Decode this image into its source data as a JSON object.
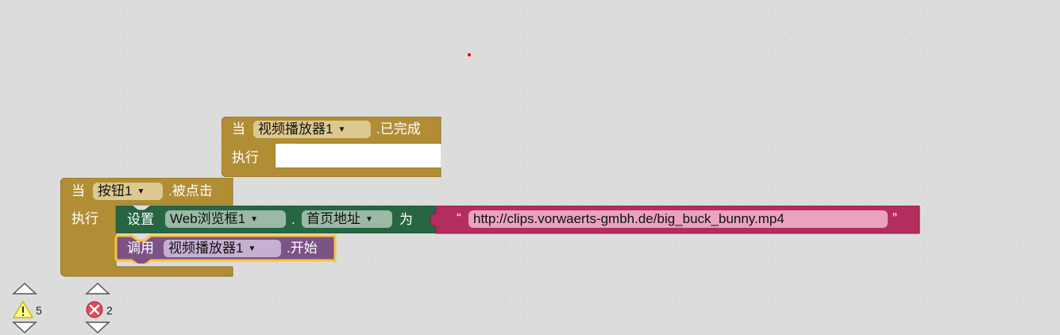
{
  "workspace": {
    "event_block_1": {
      "when_label": "当",
      "component": "视频播放器1",
      "event": ".已完成",
      "do_label": "执行"
    },
    "event_block_2": {
      "when_label": "当",
      "component": "按钮1",
      "event": ".被点击",
      "do_label": "执行"
    },
    "set_block": {
      "set_label": "设置",
      "component": "Web浏览框1",
      "dot": ".",
      "property": "首页地址",
      "to_label": "为"
    },
    "text_block": {
      "open_quote": "“",
      "value": "http://clips.vorwaerts-gmbh.de/big_buck_bunny.mp4",
      "close_quote": "”"
    },
    "call_block": {
      "call_label": "调用",
      "component": "视频播放器1",
      "method": ".开始"
    }
  },
  "indicators": {
    "warnings": {
      "count": "5",
      "icon": "warning-icon"
    },
    "errors": {
      "count": "2",
      "icon": "error-icon"
    }
  },
  "colors": {
    "event": "#b18e35",
    "event_dark": "#8c6f25",
    "set": "#266643",
    "text": "#b32d5e",
    "call": "#7c5385",
    "selected_outline": "#fcc43c"
  }
}
